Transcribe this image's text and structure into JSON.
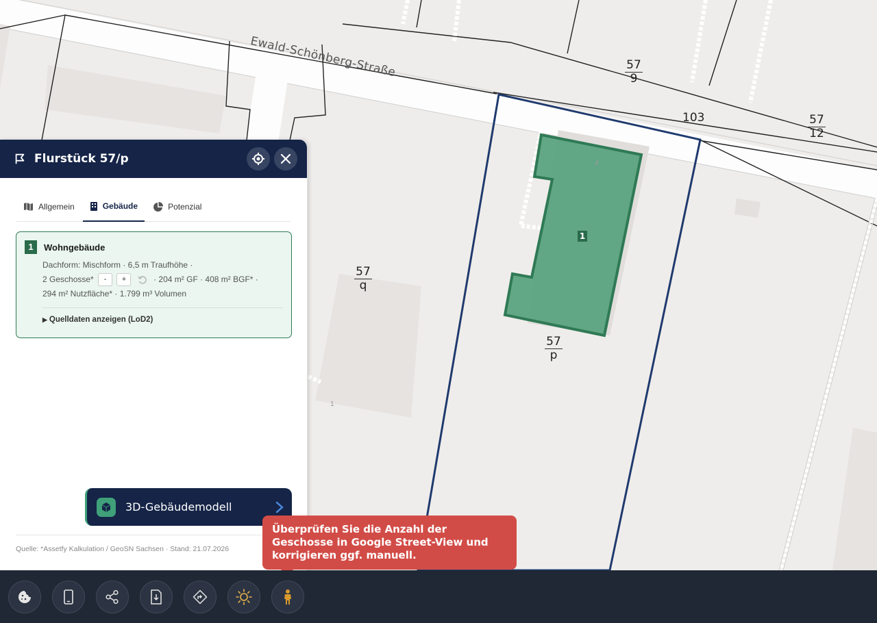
{
  "map": {
    "street_name": "Ewald-Schönberg-Straße",
    "parcel_labels": [
      {
        "id": "57-9",
        "num": "57",
        "den": "9"
      },
      {
        "id": "57-12",
        "num": "57",
        "den": "12"
      },
      {
        "id": "57-q",
        "num": "57",
        "den": "q"
      },
      {
        "id": "57-p",
        "num": "57",
        "den": "p"
      }
    ],
    "plain_label": "103",
    "building_marker": "1",
    "faint_numbers": [
      "4",
      "1"
    ],
    "colors": {
      "parcel_outline": "#1f3a6e",
      "building_fill": "#4f9e79",
      "building_stroke": "#2f7a55"
    }
  },
  "panel": {
    "title": "Flurstück 57/p",
    "tabs": [
      {
        "label": "Allgemein",
        "icon": "map-icon"
      },
      {
        "label": "Gebäude",
        "icon": "building-icon"
      },
      {
        "label": "Potenzial",
        "icon": "pie-chart-icon"
      }
    ],
    "active_tab": "Gebäude",
    "building": {
      "badge": "1",
      "title": "Wohngebäude",
      "line1": "Dachform: Mischform · 6,5 m Traufhöhe ·",
      "floors": "2 Geschosse*",
      "minus": "-",
      "plus": "+",
      "areas": "· 204 m² GF · 408 m² BGF* ·",
      "line3": "294 m² Nutzfläche* · 1.799 m³ Volumen",
      "source_toggle": "Quelldaten anzeigen (LoD2)"
    },
    "model_button": "3D-Gebäudemodell",
    "footer": "Quelle: *Assetfy Kalkulation / GeoSN Sachsen · Stand: 21.07.2026"
  },
  "tooltip": {
    "text": "Überprüfen Sie die Anzahl der Geschosse in Google Street-View und korrigieren ggf. manuell."
  },
  "toolbar": {
    "buttons": [
      "cookie-icon",
      "phone-icon",
      "share-icon",
      "download-icon",
      "directions-icon",
      "sun-icon",
      "pegman-icon"
    ]
  }
}
